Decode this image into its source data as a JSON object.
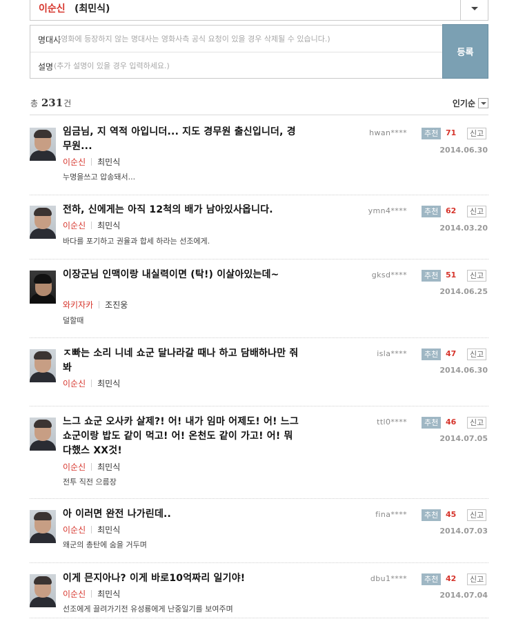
{
  "selector": {
    "character": "이순신",
    "actor": "최민식"
  },
  "form": {
    "quote_label": "명대사",
    "quote_placeholder": "(영화에 등장하지 않는 명대사는 영화사측 공식 요청이 있을 경우 삭제될 수 있습니다.)",
    "desc_label": "설명",
    "desc_placeholder": "(추가 설명이 있을 경우 입력하세요.)",
    "submit_label": "등록"
  },
  "summary": {
    "total_prefix": "총",
    "total_count": "231",
    "total_suffix": "건",
    "sort_label": "인기순"
  },
  "buttons": {
    "recommend": "추천",
    "report": "신고"
  },
  "items": [
    {
      "quote": "임금님, 지 역적 아입니더... 지도 경무원 출신입니더, 경무원...",
      "character": "이순신",
      "actor": "최민식",
      "desc": "누명을쓰고 압송돼서...",
      "user": "hwan****",
      "count": "71",
      "date": "2014.06.30",
      "avatar": "choi-minsik"
    },
    {
      "quote": "전하, 신에게는 아직 12척의 배가 남아있사옵니다.",
      "character": "이순신",
      "actor": "최민식",
      "desc": "바다를 포기하고 권율과 합세 하라는 선조에게.",
      "user": "ymn4****",
      "count": "62",
      "date": "2014.03.20",
      "avatar": "choi-minsik"
    },
    {
      "quote": "이장군님 인맥이랑 내실력이면 (탁!) 이살아있는데~",
      "character": "와키자카",
      "actor": "조진웅",
      "desc": "덜할때",
      "user": "gksd****",
      "count": "51",
      "date": "2014.06.25",
      "avatar": "jo-jinwoong"
    },
    {
      "quote": "ㅈ빠는 소리 니네 쇼군 달나라갈 때나 하고 담배하나만 줘봐",
      "character": "이순신",
      "actor": "최민식",
      "desc": "",
      "user": "isla****",
      "count": "47",
      "date": "2014.06.30",
      "avatar": "choi-minsik"
    },
    {
      "quote": "느그 쇼군 오사카 살제?! 어! 내가 임마 어제도! 어! 느그 쇼군이랑 밥도 같이 먹고! 어! 온천도 같이 가고! 어! 뭐 다했스 XX것!",
      "character": "이순신",
      "actor": "최민식",
      "desc": "전투 직전 으름장",
      "user": "ttl0****",
      "count": "46",
      "date": "2014.07.05",
      "avatar": "choi-minsik"
    },
    {
      "quote": "아 이러면 완전 나가린데..",
      "character": "이순신",
      "actor": "최민식",
      "desc": "왜군의 총탄에 숨을 거두며",
      "user": "fina****",
      "count": "45",
      "date": "2014.07.03",
      "avatar": "choi-minsik"
    },
    {
      "quote": "이게 믄지아나? 이게 바로10억짜리 일기야!",
      "character": "이순신",
      "actor": "최민식",
      "desc": "선조에게 끌려가기전 유성룡에게 난중일기를 보여주며",
      "user": "dbu1****",
      "count": "42",
      "date": "2014.07.04",
      "avatar": "choi-minsik"
    }
  ]
}
